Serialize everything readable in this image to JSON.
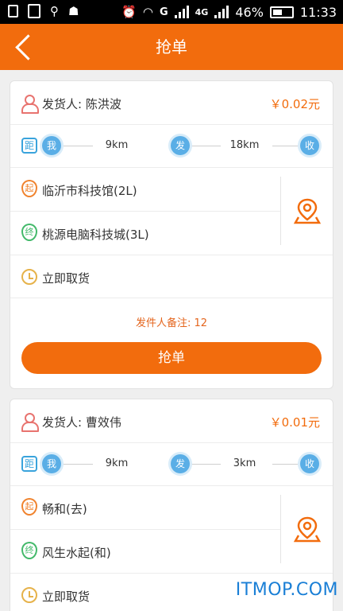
{
  "status_bar": {
    "battery": "46%",
    "time": "11:33",
    "network": "G",
    "network2": "4G"
  },
  "header": {
    "title": "抢单"
  },
  "colors": {
    "accent": "#f26c0d",
    "blue": "#5aaee6",
    "start": "#f0832e",
    "end": "#43b96a"
  },
  "orders": [
    {
      "sender_label": "发货人: 陈洪波",
      "price": "￥0.02元",
      "dist_badge": "距",
      "me_label": "我",
      "dist1": "9km",
      "send_label": "发",
      "dist2": "18km",
      "recv_label": "收",
      "start_badge": "起",
      "start": "临沂市科技馆(2L)",
      "end_badge": "终",
      "end": "桃源电脑科技城(3L)",
      "pickup": "立即取货",
      "note": "发件人备注: 12",
      "grab_label": "抢单"
    },
    {
      "sender_label": "发货人: 曹效伟",
      "price": "￥0.01元",
      "dist_badge": "距",
      "me_label": "我",
      "dist1": "9km",
      "send_label": "发",
      "dist2": "3km",
      "recv_label": "收",
      "start_badge": "起",
      "start": "畅和(去)",
      "end_badge": "终",
      "end": "风生水起(和)",
      "pickup": "立即取货"
    }
  ],
  "watermark": "ITMOP.COM"
}
